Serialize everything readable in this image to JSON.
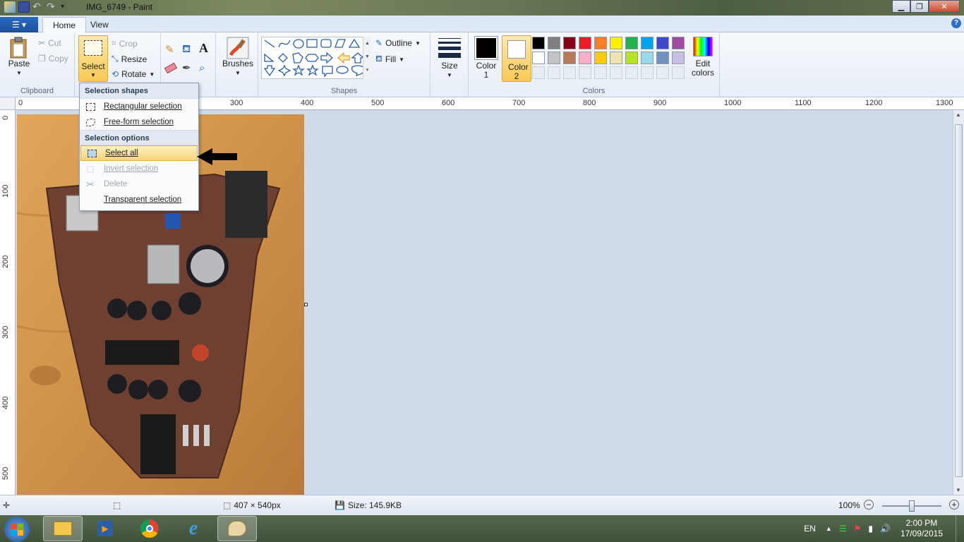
{
  "window": {
    "title": "IMG_6749 - Paint"
  },
  "tabs": [
    {
      "label": "Home"
    },
    {
      "label": "View"
    }
  ],
  "ribbon": {
    "clipboard": {
      "group_label": "Clipboard",
      "paste": "Paste",
      "cut": "Cut",
      "copy": "Copy"
    },
    "image": {
      "select": "Select",
      "crop": "Crop",
      "resize": "Resize",
      "rotate": "Rotate"
    },
    "brushes": "Brushes",
    "shapes": {
      "group_label": "Shapes",
      "outline": "Outline",
      "fill": "Fill"
    },
    "size": "Size",
    "colors": {
      "group_label": "Colors",
      "color1": "Color 1",
      "color2": "Color 2",
      "edit": "Edit colors",
      "palette": [
        "#000000",
        "#7f7f7f",
        "#880015",
        "#ed1c24",
        "#ff7f27",
        "#fff200",
        "#22b14c",
        "#00a2e8",
        "#3f48cc",
        "#a349a4",
        "#ffffff",
        "#c3c3c3",
        "#b97a57",
        "#ffaec9",
        "#ffc90e",
        "#efe4b0",
        "#b5e61d",
        "#99d9ea",
        "#7092be",
        "#c8bfe7"
      ]
    }
  },
  "dropdown": {
    "shapes_header": "Selection shapes",
    "rect": "Rectangular selection",
    "freeform": "Free-form selection",
    "options_header": "Selection options",
    "select_all": "Select all",
    "invert": "Invert selection",
    "delete": "Delete",
    "transparent": "Transparent selection"
  },
  "ruler": {
    "top": [
      "0",
      "300",
      "400",
      "500",
      "600",
      "700",
      "800",
      "900",
      "1000",
      "1100",
      "1200",
      "1300"
    ],
    "left": [
      "0",
      "100",
      "200",
      "300",
      "400",
      "500"
    ]
  },
  "status": {
    "dimensions": "407 × 540px",
    "size": "Size: 145.9KB",
    "zoom": "100%"
  },
  "taskbar": {
    "lang": "EN",
    "time": "2:00 PM",
    "date": "17/09/2015"
  }
}
